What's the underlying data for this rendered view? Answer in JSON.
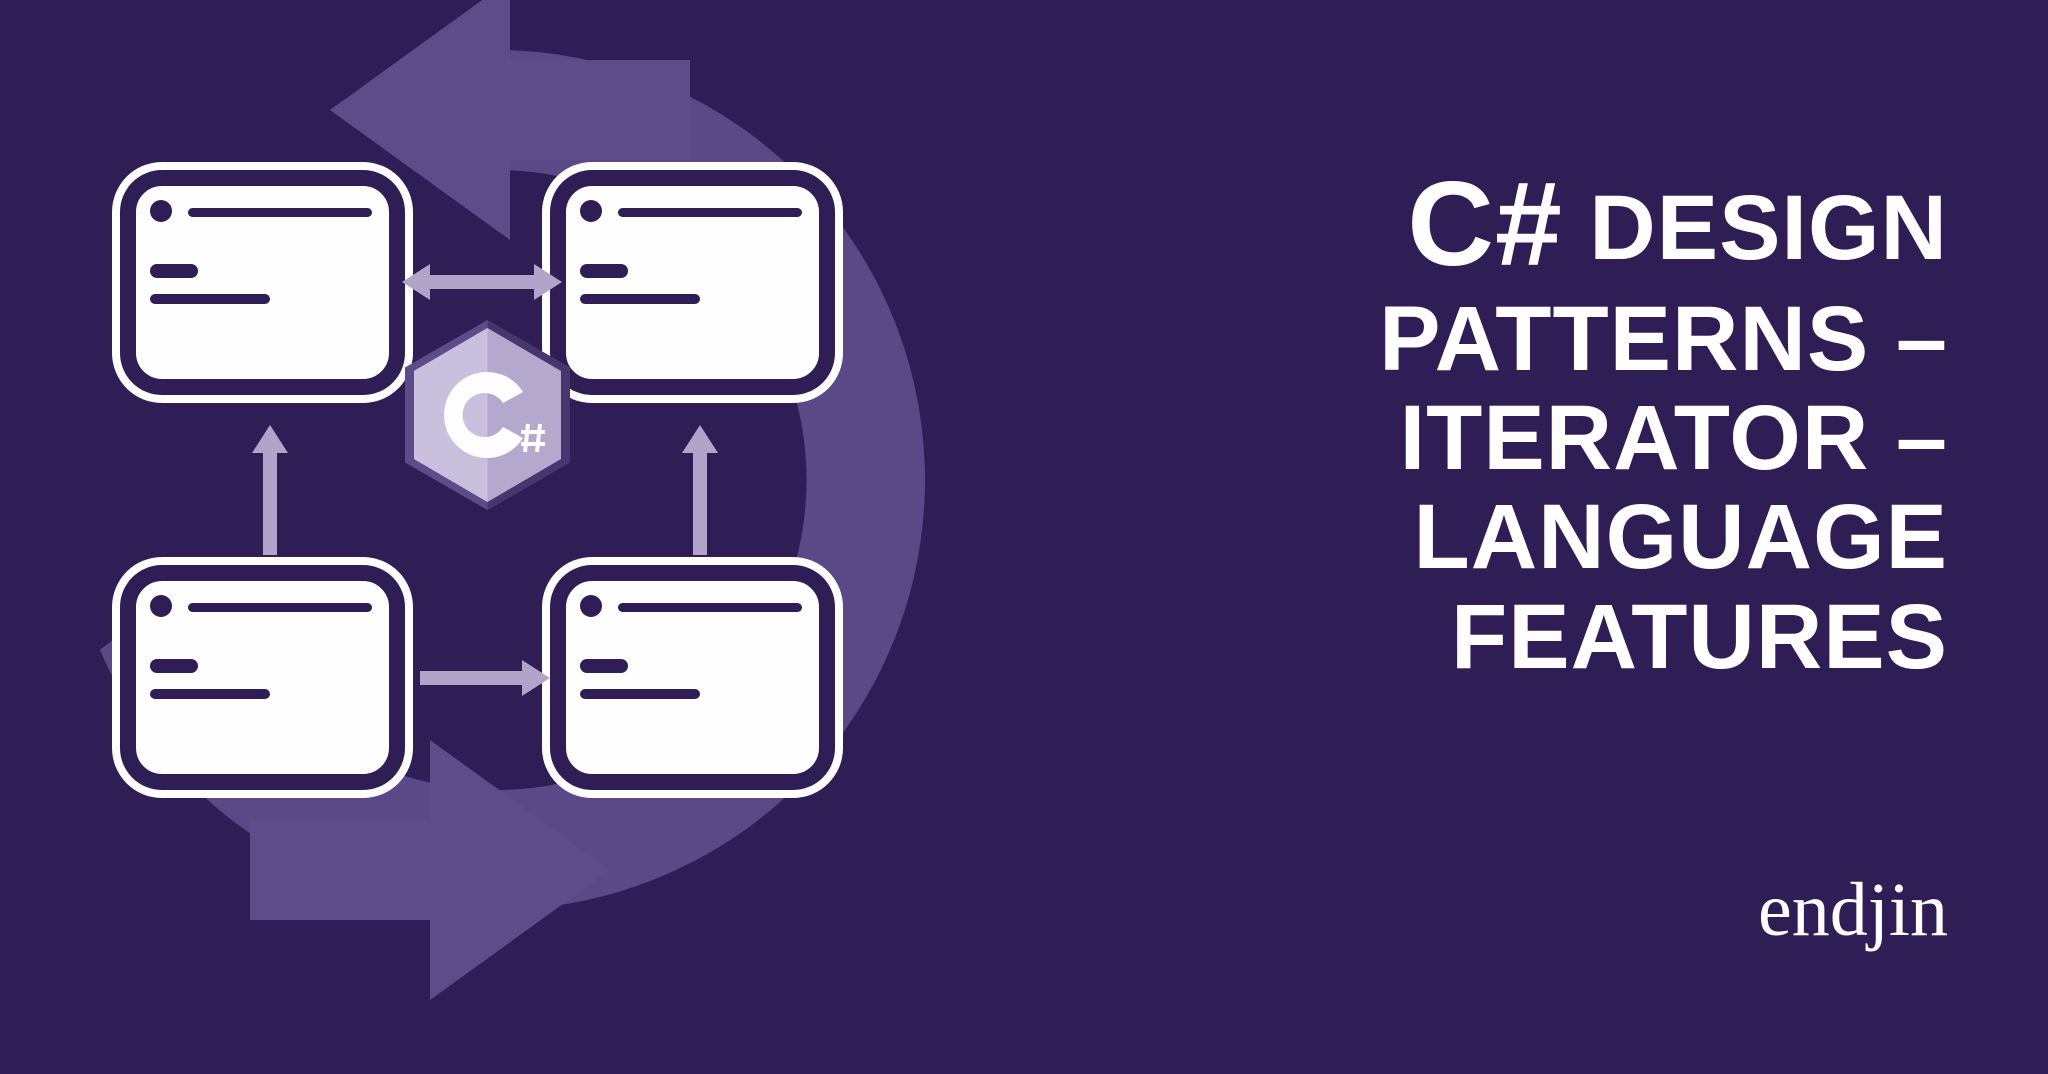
{
  "title": {
    "line1_big": "C#",
    "line1_rest": " DESIGN",
    "line2": "PATTERNS –",
    "line3": "ITERATOR –",
    "line4": "LANGUAGE",
    "line5": "FEATURES"
  },
  "brand": "endjin",
  "colors": {
    "bg": "#2f1e56",
    "accent": "#5e4b8a",
    "light": "#fefefe"
  },
  "icon_label": "csharp-hex-icon"
}
